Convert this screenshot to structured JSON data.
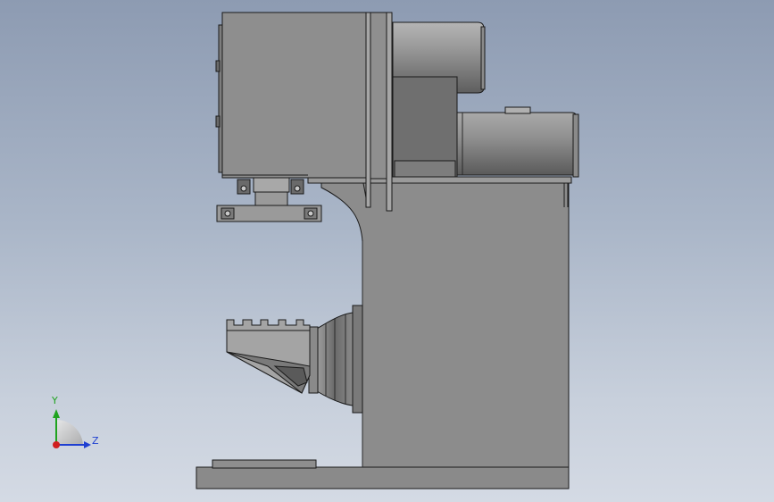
{
  "view": {
    "background_top": "#8d9bb2",
    "background_bottom": "#d4dae4",
    "part_fill": "#8c8c8c",
    "part_dark": "#6e6e6e",
    "edge_color": "#1a1a1a"
  },
  "triad": {
    "y_label": "Y",
    "z_label": "Z",
    "y_color": "#1fa31f",
    "z_color": "#1f3fd1",
    "x_color": "#d01f1f"
  }
}
